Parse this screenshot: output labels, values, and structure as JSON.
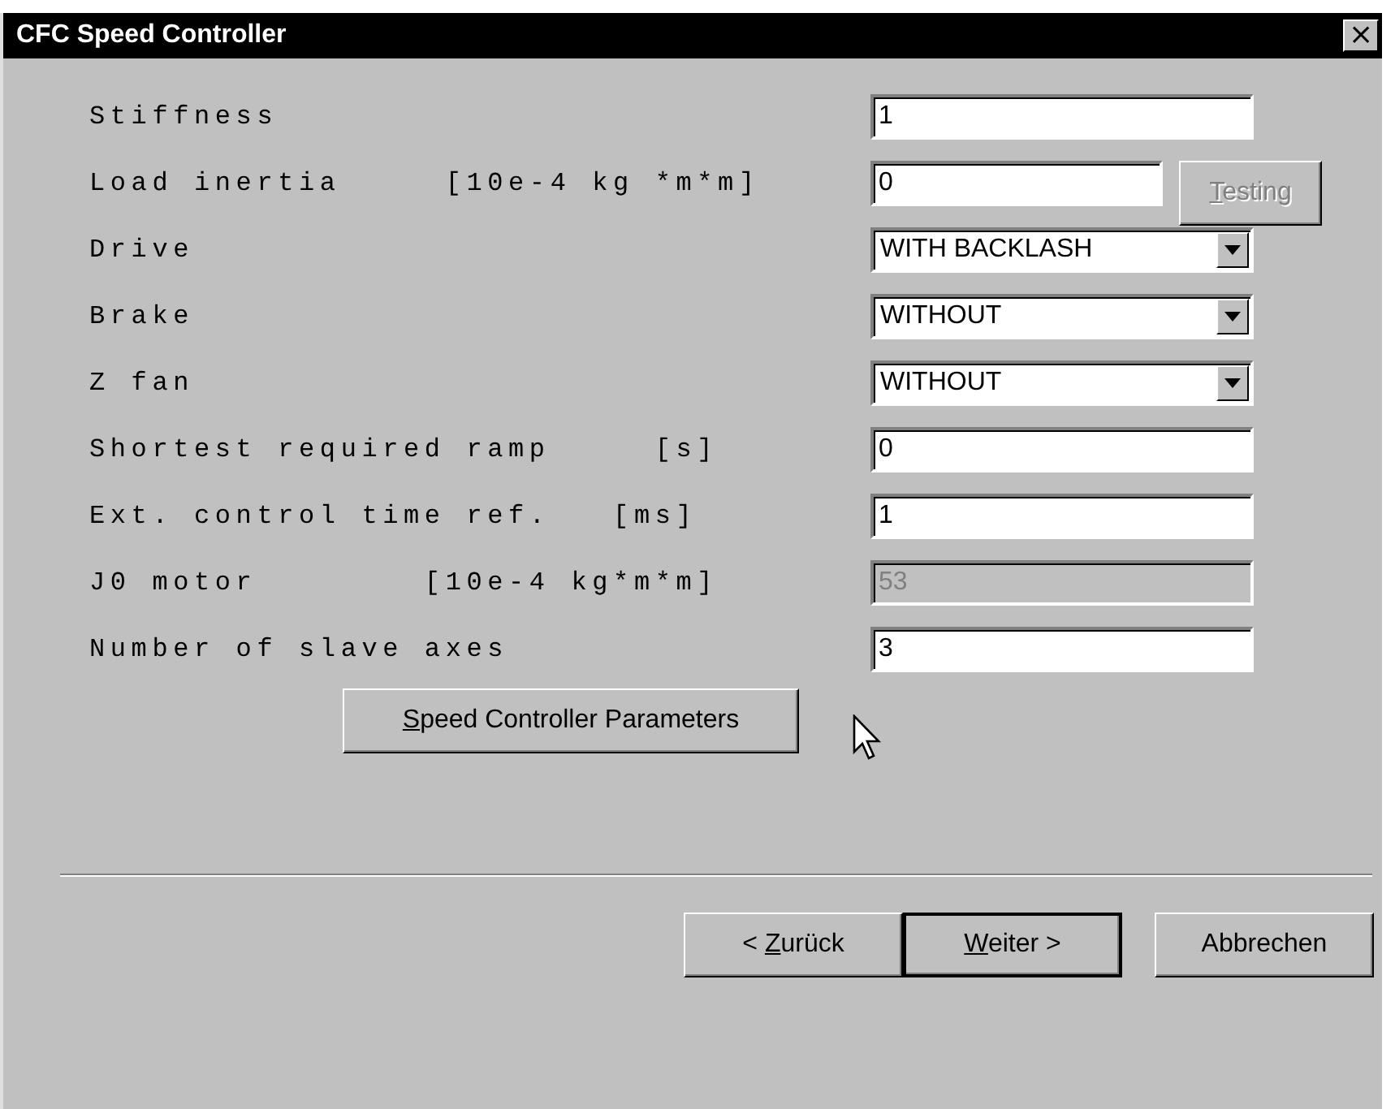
{
  "window": {
    "title": "CFC Speed Controller",
    "close": "×"
  },
  "rows": [
    {
      "kind": "text",
      "label": "Stiffness",
      "value": "1",
      "disabled": false
    },
    {
      "kind": "text",
      "label": "Load inertia     [10e-4 kg *m*m]",
      "value": "0",
      "disabled": false,
      "button": {
        "label": {
          "key": "T",
          "after": "esting"
        },
        "disabled": true
      }
    },
    {
      "kind": "select",
      "label": "Drive",
      "value": "WITH BACKLASH"
    },
    {
      "kind": "select",
      "label": "Brake",
      "value": "WITHOUT"
    },
    {
      "kind": "select",
      "label": "Z fan",
      "value": "WITHOUT"
    },
    {
      "kind": "text",
      "label": "Shortest required ramp     [s]",
      "value": "0",
      "disabled": false
    },
    {
      "kind": "text",
      "label": "Ext. control time ref.   [ms]",
      "value": "1",
      "disabled": false
    },
    {
      "kind": "text",
      "label": "J0 motor        [10e-4 kg*m*m]",
      "value": "53",
      "disabled": true
    },
    {
      "kind": "text",
      "label": "Number of slave axes",
      "value": "3",
      "disabled": false
    }
  ],
  "action_button": {
    "label": {
      "key": "S",
      "after": "peed Controller Parameters"
    }
  },
  "footer_buttons": [
    {
      "label": {
        "before": "< ",
        "key": "Z",
        "after": "urück"
      },
      "default": false
    },
    {
      "label": {
        "key": "W",
        "after": "eiter >"
      },
      "default": true
    },
    {
      "label": {
        "before": "Abbrechen"
      },
      "default": false
    }
  ]
}
